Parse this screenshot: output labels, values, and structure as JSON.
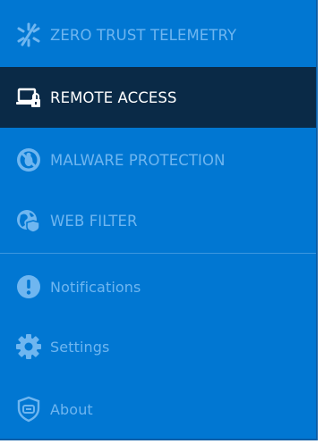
{
  "menu": {
    "items": [
      {
        "label": "ZERO TRUST TELEMETRY",
        "icon": "telemetry-icon",
        "state": "disabled"
      },
      {
        "label": "REMOTE ACCESS",
        "icon": "remote-access-laptop-lock-icon",
        "state": "active"
      },
      {
        "label": "MALWARE PROTECTION",
        "icon": "malware-bug-blocked-icon",
        "state": "disabled"
      },
      {
        "label": "WEB FILTER",
        "icon": "globe-shield-icon",
        "state": "disabled"
      },
      {
        "label": "Notifications",
        "icon": "exclamation-circle-icon",
        "state": "normal"
      },
      {
        "label": "Settings",
        "icon": "gear-icon",
        "state": "normal"
      },
      {
        "label": "About",
        "icon": "shield-info-icon",
        "state": "normal"
      }
    ]
  },
  "colors": {
    "sidebar_bg": "#0177d2",
    "active_bg": "#0a2a47",
    "muted_text": "#6fb6f0",
    "bright_text": "#ffffff"
  }
}
